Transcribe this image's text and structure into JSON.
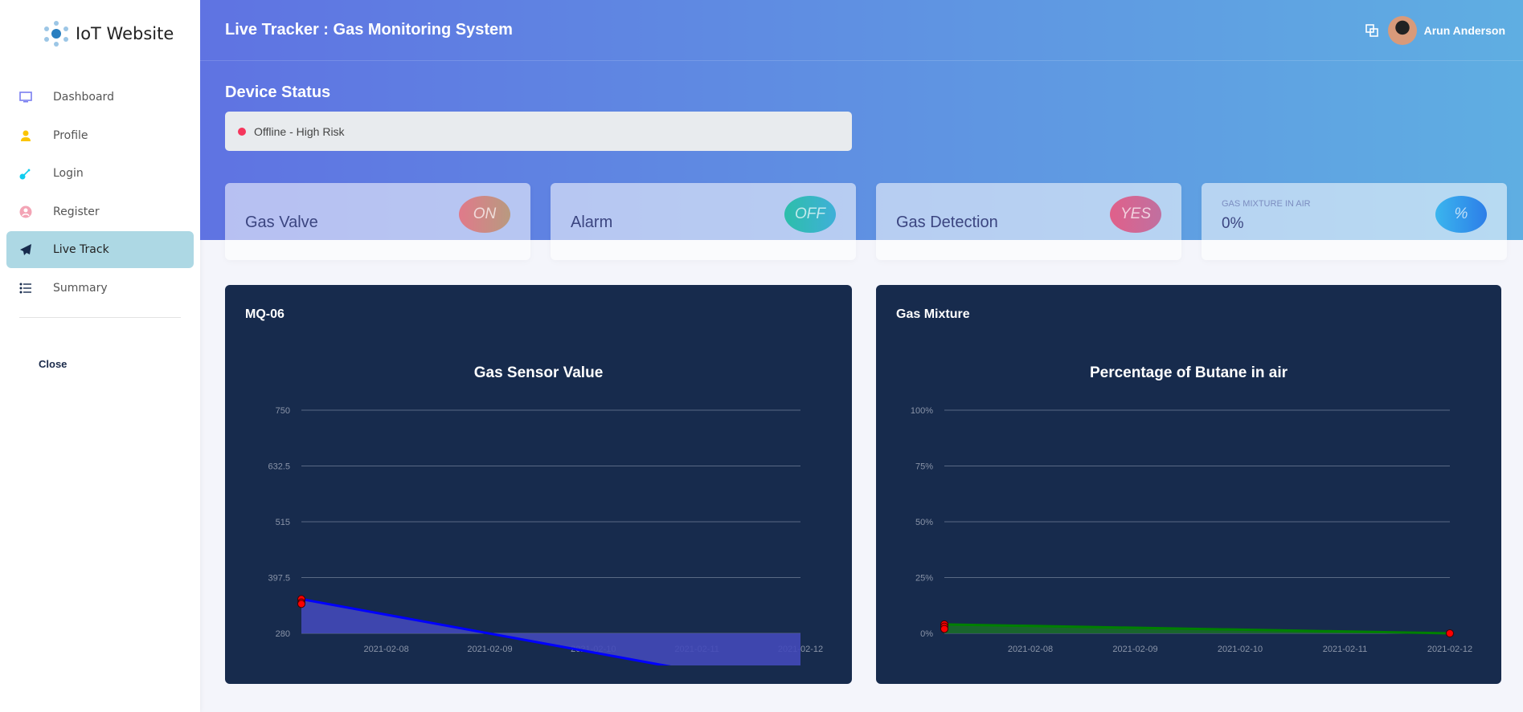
{
  "sidebar": {
    "brand": "IoT Website",
    "items": [
      {
        "label": "Dashboard",
        "icon": "monitor-icon",
        "color": "#7a7ff0"
      },
      {
        "label": "Profile",
        "icon": "user-icon",
        "color": "#fbc400"
      },
      {
        "label": "Login",
        "icon": "key-icon",
        "color": "#11cdef"
      },
      {
        "label": "Register",
        "icon": "user-circle-icon",
        "color": "#f3a4b5"
      },
      {
        "label": "Live Track",
        "icon": "send-icon",
        "color": "#172b4d"
      },
      {
        "label": "Summary",
        "icon": "list-icon",
        "color": "#172b4d"
      }
    ],
    "close": "Close"
  },
  "header": {
    "title": "Live Tracker : Gas Monitoring System",
    "user": "Arun Anderson"
  },
  "device_status": {
    "heading": "Device Status",
    "text": "Offline - High Risk",
    "dot_color": "#f5365c"
  },
  "cards": [
    {
      "label": "Gas Valve",
      "badge": "ON",
      "gradient": [
        "#e07a8a",
        "#b89a80"
      ]
    },
    {
      "label": "Alarm",
      "badge": "OFF",
      "gradient": [
        "#2dbeaa",
        "#3fb0d8"
      ]
    },
    {
      "label": "Gas Detection",
      "badge": "YES",
      "gradient": [
        "#e0608a",
        "#c070a0"
      ]
    },
    {
      "small": "GAS MIXTURE IN AIR",
      "value": "0%",
      "badge": "%",
      "gradient": [
        "#3ab5ee",
        "#2d7ee8"
      ]
    }
  ],
  "chart_data": [
    {
      "panel": "MQ-06",
      "type": "area",
      "title": "Gas Sensor Value",
      "ylim": [
        280,
        750
      ],
      "yticks": [
        "750",
        "632.5",
        "515",
        "397.5",
        "280"
      ],
      "xticks": [
        "2021-02-08",
        "2021-02-09",
        "2021-02-10",
        "2021-02-11",
        "2021-02-12"
      ],
      "xrange": [
        -0.82,
        4
      ],
      "points": [
        [
          -0.82,
          352
        ],
        [
          -0.82,
          345
        ],
        [
          -0.82,
          342
        ],
        [
          4,
          160
        ]
      ],
      "line_color": "#0000ff",
      "fill_color": "#4349b9",
      "marker_color": "#ff0000"
    },
    {
      "panel": "Gas Mixture",
      "type": "area",
      "title": "Percentage of Butane in air",
      "ylim": [
        0,
        100
      ],
      "yticks": [
        "100%",
        "75%",
        "50%",
        "25%",
        "0%"
      ],
      "xticks": [
        "2021-02-08",
        "2021-02-09",
        "2021-02-10",
        "2021-02-11",
        "2021-02-12"
      ],
      "xrange": [
        -0.82,
        4
      ],
      "points": [
        [
          -0.82,
          4
        ],
        [
          -0.82,
          3
        ],
        [
          -0.82,
          2
        ],
        [
          4,
          0
        ]
      ],
      "line_color": "#008000",
      "fill_color": "#1a6b2a",
      "marker_color": "#ff0000"
    }
  ]
}
